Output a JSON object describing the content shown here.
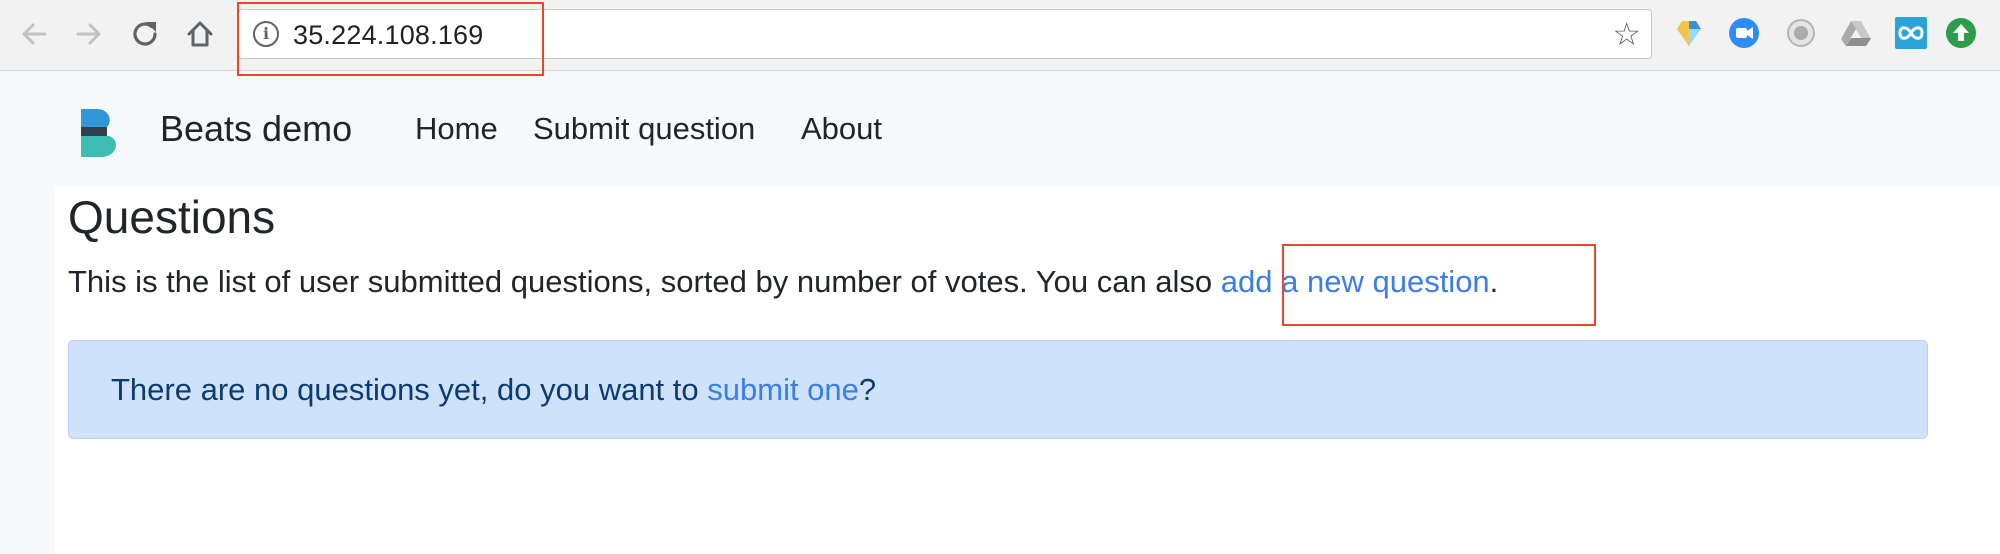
{
  "browser": {
    "url": "35.224.108.169",
    "colors": {
      "highlight_box": "#e8472b"
    }
  },
  "navbar": {
    "brand": "Beats demo",
    "links": [
      "Home",
      "Submit question",
      "About"
    ]
  },
  "main": {
    "title": "Questions",
    "lead_text": "This is the list of user submitted questions, sorted by number of votes. You can also ",
    "lead_link": "add a new question",
    "lead_end": ".",
    "alert_text": "There are no questions yet, do you want to ",
    "alert_link": "submit one",
    "alert_end": "?"
  },
  "colors": {
    "link": "#3b7de9",
    "alert_bg": "#cfe2fb",
    "alert_text": "#0c3a72"
  }
}
